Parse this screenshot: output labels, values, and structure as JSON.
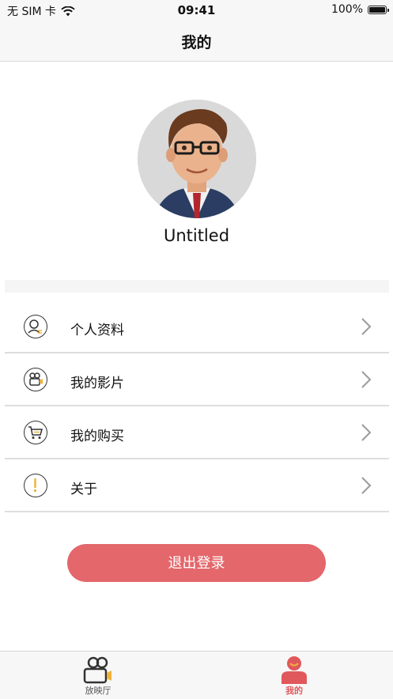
{
  "status_bar": {
    "carrier": "无 SIM 卡",
    "time": "09:41",
    "battery": "100%"
  },
  "nav": {
    "title": "我的"
  },
  "profile": {
    "name": "Untitled"
  },
  "menu": [
    {
      "label": "个人资料",
      "icon": "profile-icon"
    },
    {
      "label": "我的影片",
      "icon": "film-camera-icon"
    },
    {
      "label": "我的购买",
      "icon": "cart-icon"
    },
    {
      "label": "关于",
      "icon": "exclamation-icon"
    }
  ],
  "logout_label": "退出登录",
  "tabs": [
    {
      "label": "放映厅",
      "icon": "video-camera-icon",
      "active": false
    },
    {
      "label": "我的",
      "icon": "person-icon",
      "active": true
    }
  ],
  "colors": {
    "accent": "#e3676b",
    "active_tab": "#e0585c",
    "icon_accent": "#f0b23a"
  }
}
